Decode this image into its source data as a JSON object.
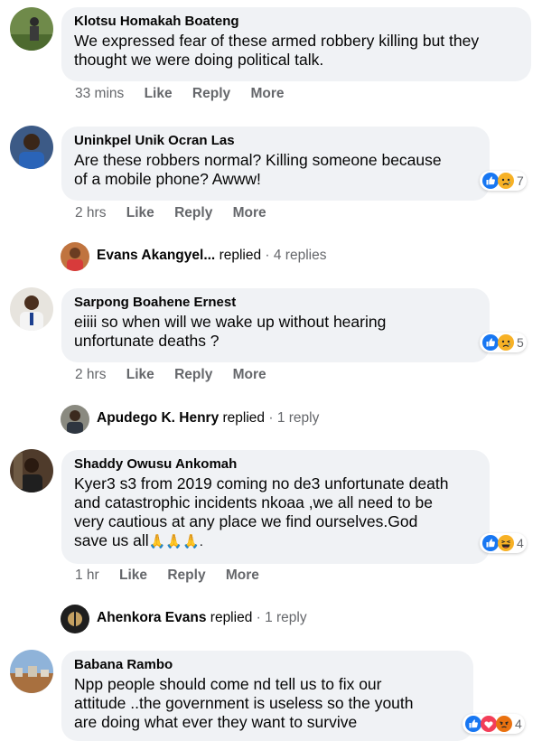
{
  "comments": [
    {
      "author": "Klotsu Homakah Boateng",
      "text": "We expressed fear of these armed robbery killing but they\nthought we were doing political talk.",
      "time": "33 mins",
      "like": "Like",
      "reply": "Reply",
      "more": "More"
    },
    {
      "author": "Uninkpel Unik Ocran Las",
      "text": "Are these robbers normal? Killing someone because\nof a mobile phone? Awww!",
      "time": "2 hrs",
      "like": "Like",
      "reply": "Reply",
      "more": "More",
      "reactions": {
        "count": "7",
        "icons": [
          "like-icon",
          "sad-icon"
        ]
      },
      "replies": {
        "name": "Evans Akangyel...",
        "verb": "replied",
        "count": "· 4 replies"
      }
    },
    {
      "author": "Sarpong Boahene Ernest",
      "text": "eiiii so when will we wake up without hearing\nunfortunate deaths ?",
      "time": "2 hrs",
      "like": "Like",
      "reply": "Reply",
      "more": "More",
      "reactions": {
        "count": "5",
        "icons": [
          "like-icon",
          "sad-icon"
        ]
      },
      "replies": {
        "name": "Apudego K. Henry",
        "verb": "replied",
        "count": "· 1 reply"
      }
    },
    {
      "author": "Shaddy Owusu Ankomah",
      "text": "Kyer3 s3 from 2019 coming no de3 unfortunate death\nand catastrophic incidents nkoaa ,we all need to be\nvery cautious at any place we find ourselves.God\nsave us all",
      "text_tail": "🙏🙏🙏.",
      "time": "1 hr",
      "like": "Like",
      "reply": "Reply",
      "more": "More",
      "reactions": {
        "count": "4",
        "icons": [
          "like-icon",
          "haha-icon"
        ]
      },
      "replies": {
        "name": "Ahenkora Evans",
        "verb": "replied",
        "count": "· 1 reply"
      }
    },
    {
      "author": "Babana Rambo",
      "text": "Npp people should come nd tell us to fix our\nattitude ..the government is useless so the youth\nare doing what ever they want to survive",
      "reactions": {
        "count": "4",
        "icons": [
          "like-icon",
          "love-icon",
          "angry-icon"
        ]
      }
    }
  ],
  "colors": {
    "bubble": "#f0f2f5",
    "meta": "#65676b",
    "like_blue": "#1877f2",
    "reaction_yellow": "#f7b125",
    "love_red": "#f33e58",
    "angry_orange": "#e9710f"
  }
}
